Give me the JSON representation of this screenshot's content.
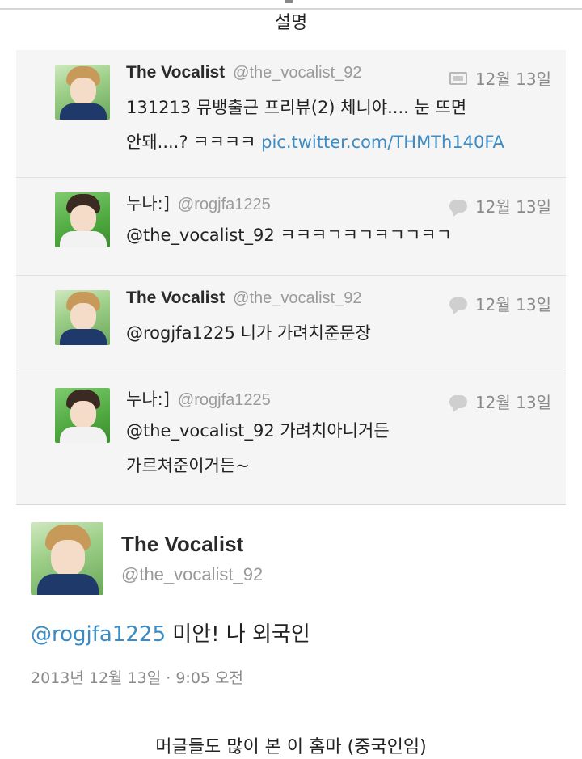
{
  "captions": {
    "top": "설명",
    "bottom": "머글들도 많이 본 이 홈마 (중국인임)"
  },
  "thread": [
    {
      "avatar": "baekhyun-avatar",
      "name": "The Vocalist",
      "handle": "@the_vocalist_92",
      "icon": "media-icon",
      "date": "12월 13일",
      "text_lines": [
        "131213 뮤뱅출근 프리뷰(2) 체니야.... 눈 뜨면",
        "안돼....? ㅋㅋㅋㅋ "
      ],
      "link": "pic.twitter.com/THMTh140FA"
    },
    {
      "avatar": "chen-avatar",
      "name": "누나:]",
      "handle": "@rogjfa1225",
      "icon": "reply-icon",
      "date": "12월 13일",
      "text_lines": [
        "@the_vocalist_92 ㅋㅋㅋㄱㅋㄱㅋㄱㄱㅋㄱ"
      ]
    },
    {
      "avatar": "baekhyun-avatar",
      "name": "The Vocalist",
      "handle": "@the_vocalist_92",
      "icon": "reply-icon",
      "date": "12월 13일",
      "text_lines": [
        "@rogjfa1225 니가 가려치준문장"
      ]
    },
    {
      "avatar": "chen-avatar",
      "name": "누나:]",
      "handle": "@rogjfa1225",
      "icon": "reply-icon",
      "date": "12월 13일",
      "text_lines": [
        "@the_vocalist_92 가려치아니거든",
        "가르쳐준이거든~"
      ]
    }
  ],
  "main_tweet": {
    "name": "The Vocalist",
    "handle": "@the_vocalist_92",
    "mention": "@rogjfa1225",
    "text": " 미안! 나 외국인",
    "timestamp": "2013년 12월 13일 · 9:05 오전"
  },
  "colors": {
    "link": "#3b8bc4",
    "thread_bg": "#f5f5f5"
  }
}
